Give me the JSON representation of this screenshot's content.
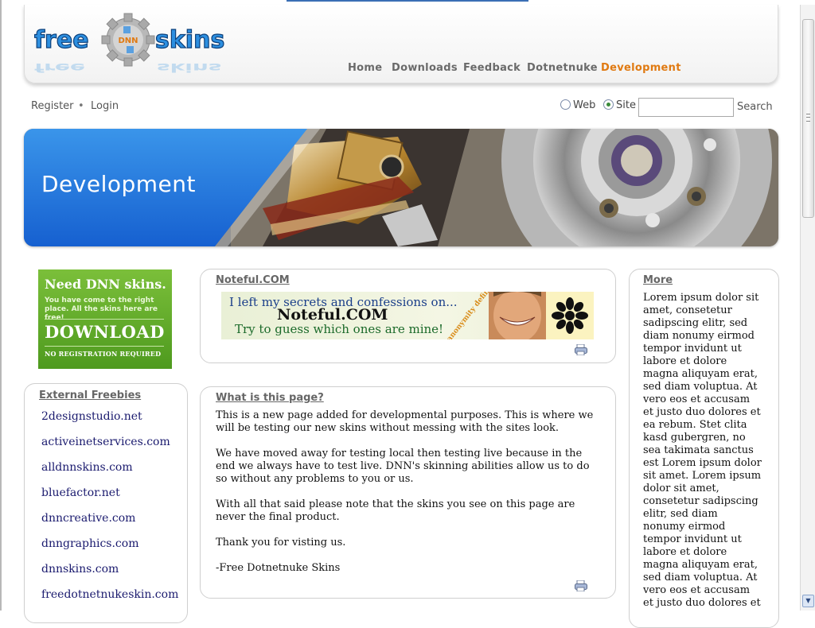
{
  "header": {
    "logo": {
      "left_word": "free",
      "right_word": "skins",
      "gear_text": "DNN"
    },
    "nav": [
      {
        "label": "Home",
        "active": false
      },
      {
        "label": "Downloads",
        "active": false
      },
      {
        "label": "Feedback",
        "active": false
      },
      {
        "label": "Dotnetnuke",
        "active": false
      },
      {
        "label": "Development",
        "active": true
      }
    ],
    "accent_color": "#e07a12"
  },
  "account": {
    "register": "Register",
    "separator": "•",
    "login": "Login"
  },
  "search": {
    "options": [
      {
        "label": "Web",
        "selected": false
      },
      {
        "label": "Site",
        "selected": true
      }
    ],
    "value": "",
    "button": "Search"
  },
  "banner": {
    "title": "Development"
  },
  "ad": {
    "headline": "Need DNN skins.",
    "subline": "You have come to the right place. All the skins here are free!",
    "cta": "DOWNLOAD",
    "footer": "NO REGISTRATION REQUIRED"
  },
  "external_freebies": {
    "title": "External Freebies",
    "links": [
      "2designstudio.net",
      "activeinetservices.com",
      "alldnnskins.com",
      "bluefactor.net",
      "dnncreative.com",
      "dnngraphics.com",
      "dnnskins.com",
      "freedotnetnukeskin.com"
    ]
  },
  "noteful_box": {
    "title": "Noteful.COM",
    "banner_line1": "I left my secrets and confessions on...",
    "banner_brand": "Noteful.COM",
    "banner_line2": "Try to guess which ones are mine!",
    "banner_stamp": "anonymity defined"
  },
  "what_box": {
    "title": "What is this page?",
    "paragraphs": [
      "This is a new page added for developmental purposes. This is where we will be testing our new skins without messing with the sites look.",
      "We have moved away for testing local then testing live because in the end we always have to test live. DNN's skinning abilities allow us to do so without any problems to you or us.",
      "With all that said please note that the skins you see on this page are never the final product.",
      "Thank you for visting us.",
      "-Free Dotnetnuke Skins"
    ]
  },
  "more_box": {
    "title": "More",
    "text": "Lorem ipsum dolor sit amet, consetetur sadipscing elitr, sed diam nonumy eirmod tempor invidunt ut labore et dolore magna aliquyam erat, sed diam voluptua. At vero eos et accusam et justo duo dolores et ea rebum. Stet clita kasd gubergren, no sea takimata sanctus est Lorem ipsum dolor sit amet. Lorem ipsum dolor sit amet, consetetur sadipscing elitr, sed diam nonumy eirmod tempor invidunt ut labore et dolore magna aliquyam erat, sed diam voluptua. At vero eos et accusam et justo duo dolores et ea rebum. Stet clita kasd"
  },
  "icons": {
    "print": "print-icon",
    "scroll_up": "scroll-up-icon",
    "scroll_down": "scroll-down-icon"
  }
}
